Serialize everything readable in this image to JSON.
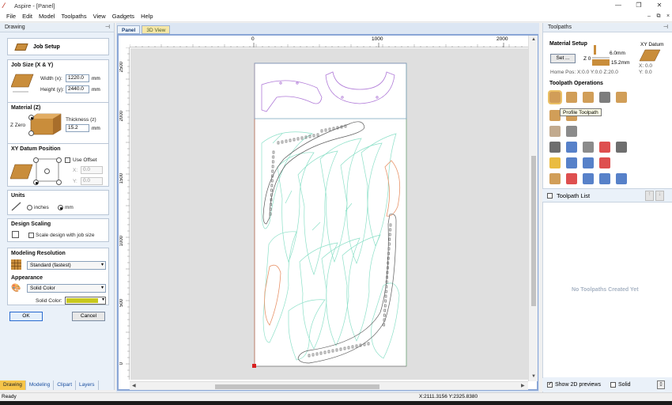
{
  "window": {
    "title": "Aspire - [Panel]"
  },
  "menu": [
    "File",
    "Edit",
    "Model",
    "Toolpaths",
    "View",
    "Gadgets",
    "Help"
  ],
  "left": {
    "header": "Drawing",
    "job_setup": "Job Setup",
    "job_size": {
      "title": "Job Size (X & Y)",
      "width_label": "Width (x):",
      "width_value": "1220.0",
      "height_label": "Height (y):",
      "height_value": "2440.0",
      "unit": "mm"
    },
    "material": {
      "title": "Material (Z)",
      "thickness_label": "Thickness (z)",
      "thickness_value": "15.2",
      "unit": "mm",
      "zzero_label": "Z Zero"
    },
    "datum": {
      "title": "XY Datum Position",
      "offset_label": "Use Offset",
      "x_label": "X:",
      "x_value": "0.0",
      "y_label": "Y:",
      "y_value": "0.0"
    },
    "units": {
      "title": "Units",
      "inches": "inches",
      "mm": "mm"
    },
    "scaling": {
      "title": "Design Scaling",
      "label": "Scale design with job size"
    },
    "modeling": {
      "title": "Modeling Resolution",
      "value": "Standard (fastest)"
    },
    "appearance": {
      "title": "Appearance",
      "value": "Solid Color",
      "solid_label": "Solid Color:",
      "solid_color": "#c8c81e"
    },
    "ok": "OK",
    "cancel": "Cancel",
    "tabs": [
      "Drawing",
      "Modeling",
      "Clipart",
      "Layers"
    ]
  },
  "view": {
    "tabs": [
      "Panel",
      "3D View"
    ],
    "ruler_top": [
      "0",
      "1000",
      "2000"
    ],
    "ruler_left": [
      "2500",
      "2000",
      "1500",
      "1000",
      "500",
      "0"
    ]
  },
  "right": {
    "header": "Toolpaths",
    "material_setup": "Material Setup",
    "set_button": "Set ...",
    "z0_label": "Z 0",
    "dim_top": "6.0mm",
    "dim_bottom": "15.2mm",
    "home_pos": "Home Pos:  X:0.0 Y:0.0 Z:20.0",
    "xy_datum": "XY Datum",
    "datum_x": "X: 0.0",
    "datum_y": "Y: 0.0",
    "ops_title": "Toolpath Operations",
    "tooltip": "Profile Toolpath",
    "list_title": "Toolpath List",
    "empty": "No Toolpaths Created Yet",
    "show2d": "Show 2D previews",
    "solid": "Solid"
  },
  "status": {
    "left": "Ready",
    "coords": "X:2111.3156 Y:2325.8380"
  }
}
